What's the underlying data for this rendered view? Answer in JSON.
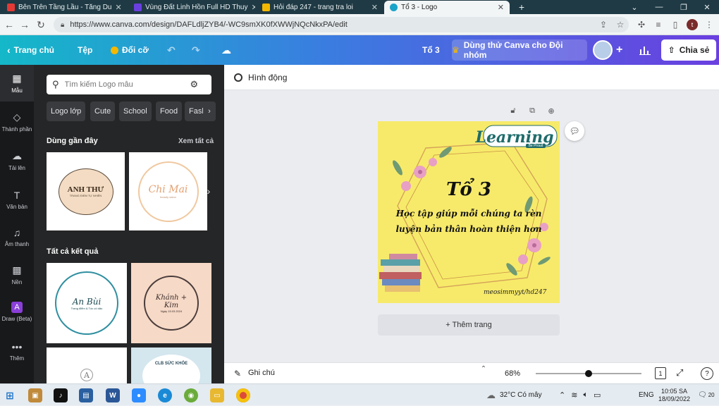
{
  "browser": {
    "tabs": [
      {
        "title": "Bên Trên Tầng Lầu - Tăng Du",
        "favicon_color": "#e53935"
      },
      {
        "title": "Vùng Đất Linh Hồn Full HD Thuy",
        "favicon_color": "#6a3fe0"
      },
      {
        "title": "Hỏi đáp 247 - trang tra loi",
        "favicon_color": "#f5b800"
      },
      {
        "title": "Tổ 3 - Logo",
        "favicon_color": "#1aa3c9"
      }
    ],
    "new_tab": "+",
    "url": "https://www.canva.com/design/DAFLdljZYB4/-WC9smXK0fXWWjNQcNkxPA/edit",
    "profile_initial": "t"
  },
  "header": {
    "home": "Trang chủ",
    "file": "Tệp",
    "resize": "Đổi cỡ",
    "design_title": "Tổ 3",
    "trial": "Dùng thử Canva cho Đội nhóm",
    "share": "Chia sẻ"
  },
  "rail": [
    {
      "label": "Mẫu",
      "icon": "template-icon"
    },
    {
      "label": "Thành phần",
      "icon": "elements-icon"
    },
    {
      "label": "Tải lên",
      "icon": "upload-icon"
    },
    {
      "label": "Văn bản",
      "icon": "text-icon"
    },
    {
      "label": "Âm thanh",
      "icon": "music-icon"
    },
    {
      "label": "Nền",
      "icon": "background-icon"
    },
    {
      "label": "Draw (Beta)",
      "icon": "draw-icon"
    },
    {
      "label": "Thêm",
      "icon": "more-icon"
    }
  ],
  "panel": {
    "search_placeholder": "Tìm kiếm Logo mẫu",
    "chips": [
      "Logo lớp",
      "Cute",
      "School",
      "Food",
      "Fashi"
    ],
    "recent_title": "Dùng gần đây",
    "see_all": "Xem tất cả",
    "all_results_title": "Tất cả kết quả",
    "recent": [
      {
        "name": "ANH THƯ",
        "sub": "TRANG ĐIỂM TỰ NHIÊN"
      },
      {
        "name": "Chi Mai",
        "sub": "beauty salon"
      }
    ],
    "results": [
      {
        "name": "An Bùi",
        "sub": "Trang điểm & Tóc cô dâu"
      },
      {
        "name": "Khánh + Kim",
        "sub": "Ngày 15.03.2024"
      },
      {
        "name": "A",
        "sub": ""
      },
      {
        "name": "CLB SỨC KHỎE",
        "sub": ""
      }
    ]
  },
  "editor": {
    "animate": "Hình động",
    "add_page": "+ Thêm trang",
    "notes": "Ghi chú",
    "zoom": "68%",
    "zoom_fraction": 0.5,
    "page_count": "1"
  },
  "design": {
    "badge": "Learning",
    "badge_sub": "Be Proud",
    "title": "Tổ 3",
    "line1": "Học tập giúp mỗi chúng ta rèn",
    "line2": "luyện bản thân hoàn thiện hơn",
    "signature": "meosimmyyt/hd247"
  },
  "taskbar": {
    "weather": "32°C  Có mây",
    "lang": "ENG",
    "time": "10:05 SA",
    "date": "18/09/2022",
    "notifications": "20"
  }
}
